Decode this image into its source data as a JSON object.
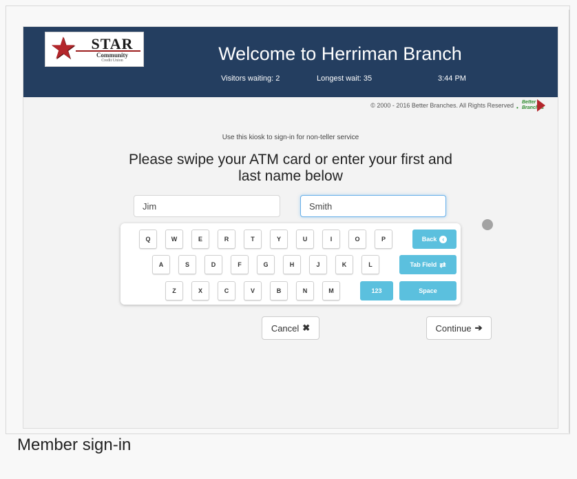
{
  "header": {
    "logo": {
      "brand": "STAR",
      "line2": "Community",
      "line3": "Credit Union"
    },
    "title": "Welcome to Herriman Branch",
    "visitors_waiting": "Visitors waiting: 2",
    "longest_wait": "Longest wait: 35",
    "time": "3:44 PM"
  },
  "footer_bar": {
    "copyright": "© 2000 - 2016 Better Branches. All Rights Reserved",
    "partner_logo": {
      "line1": "Better",
      "line2": "Branches"
    }
  },
  "form": {
    "instruction": "Use this kiosk to sign-in for non-teller service",
    "prompt": "Please swipe your ATM card or enter your first and last name below",
    "first_name_value": "Jim",
    "last_name_value": "Smith"
  },
  "keyboard": {
    "row1": [
      "Q",
      "W",
      "E",
      "R",
      "T",
      "Y",
      "U",
      "I",
      "O",
      "P"
    ],
    "row2": [
      "A",
      "S",
      "D",
      "F",
      "G",
      "H",
      "J",
      "K",
      "L"
    ],
    "row3": [
      "Z",
      "X",
      "C",
      "V",
      "B",
      "N",
      "M"
    ],
    "back_label": "Back",
    "tab_label": "Tab Field",
    "numbers_label": "123",
    "space_label": "Space",
    "accent_color": "#5bc0de"
  },
  "actions": {
    "cancel_label": "Cancel",
    "continue_label": "Continue"
  },
  "caption": "Member sign-in"
}
